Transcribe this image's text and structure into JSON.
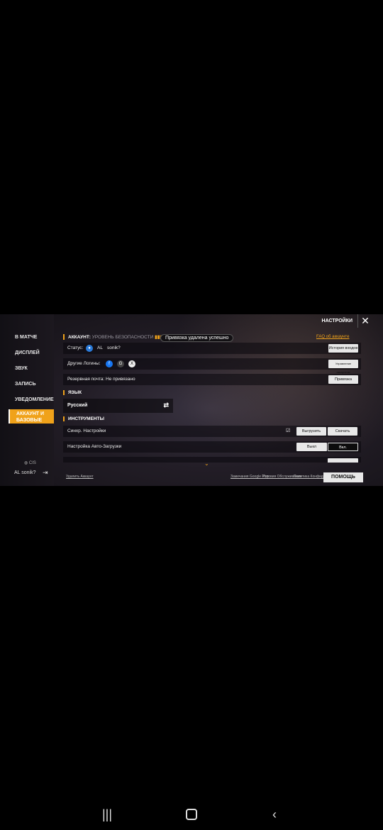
{
  "sidebar": {
    "items": [
      {
        "label": "В МАТЧЕ"
      },
      {
        "label": "ДИСПЛЕЙ"
      },
      {
        "label": "ЗВУК"
      },
      {
        "label": "ЗАПИСЬ"
      },
      {
        "label": "УВЕДОМЛЕНИЕ"
      },
      {
        "label": "АККАУНТ И БАЗОВЫЕ"
      }
    ],
    "region": "CIS",
    "user_prefix": "AL",
    "username": "sonik?"
  },
  "header": {
    "title": "НАСТРОЙКИ"
  },
  "account": {
    "heading": "АККАУНТ:",
    "security_label": "УРОВЕНЬ БЕЗОПАСНОСТИ",
    "toast": "Привязка удалена успешно",
    "faq": "FAQ об аккаунте",
    "status_label": "Статус:",
    "status_prefix": "AL",
    "status_name": "sonik?",
    "history_button": "История входов",
    "other_logins_label": "Другие Логины:",
    "manage_button": "Управление аккаунтом",
    "backup_email_label": "Резервная почта:",
    "backup_email_value": "Не привязано",
    "bind_button": "Привязка"
  },
  "language": {
    "heading": "ЯЗЫК",
    "value": "Русский"
  },
  "tools": {
    "heading": "ИНСТРУМЕНТЫ",
    "sync_label": "Синхр. Настройки",
    "upload_button": "Выгрузить",
    "download_button": "Скачать",
    "autoload_label": "Настройка Авто-Загрузки",
    "off_button": "Выкл",
    "on_button": "Вкл."
  },
  "footer": {
    "delete_account": "Удалить Аккаунт",
    "link1": "Замечания Google Play",
    "link2": "Условия Обслуживания",
    "link3": "Политика Конфиденц.",
    "help_button": "ПОМОЩЬ"
  },
  "colors": {
    "accent": "#f0a21a"
  }
}
